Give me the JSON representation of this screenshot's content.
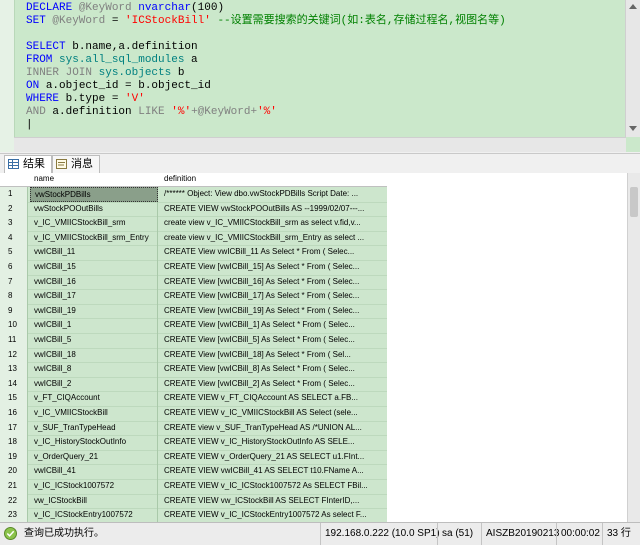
{
  "editor": {
    "lines": [
      {
        "parts": [
          {
            "c": "kw",
            "t": "DECLARE "
          },
          {
            "c": "gray",
            "t": "@KeyWord "
          },
          {
            "c": "kw",
            "t": "nvarchar"
          },
          {
            "c": "var",
            "t": "(100)"
          }
        ]
      },
      {
        "parts": [
          {
            "c": "kw",
            "t": "SET "
          },
          {
            "c": "gray",
            "t": "@KeyWord "
          },
          {
            "c": "var",
            "t": "= "
          },
          {
            "c": "str",
            "t": "'ICStockBill'"
          },
          {
            "c": "cmt",
            "t": " --设置需要搜索的关键词(如:表名,存储过程名,视图名等)"
          }
        ]
      },
      {
        "parts": []
      },
      {
        "parts": [
          {
            "c": "kw",
            "t": "SELECT "
          },
          {
            "c": "var",
            "t": "b.name,a.definition"
          }
        ]
      },
      {
        "parts": [
          {
            "c": "kw",
            "t": "FROM "
          },
          {
            "c": "obj",
            "t": "sys.all_sql_modules "
          },
          {
            "c": "var",
            "t": "a"
          }
        ]
      },
      {
        "parts": [
          {
            "c": "gray",
            "t": "INNER JOIN "
          },
          {
            "c": "obj",
            "t": "sys.objects "
          },
          {
            "c": "var",
            "t": "b"
          }
        ]
      },
      {
        "parts": [
          {
            "c": "kw",
            "t": "ON "
          },
          {
            "c": "var",
            "t": "a.object_id = b.object_id"
          }
        ]
      },
      {
        "parts": [
          {
            "c": "kw",
            "t": "WHERE "
          },
          {
            "c": "var",
            "t": "b.type = "
          },
          {
            "c": "str",
            "t": "'V'"
          }
        ]
      },
      {
        "parts": [
          {
            "c": "gray",
            "t": "AND "
          },
          {
            "c": "var",
            "t": "a.definition "
          },
          {
            "c": "gray",
            "t": "LIKE "
          },
          {
            "c": "str",
            "t": "'%'"
          },
          {
            "c": "gray",
            "t": "+@KeyWord+"
          },
          {
            "c": "str",
            "t": "'%'"
          }
        ]
      },
      {
        "parts": [
          {
            "c": "var",
            "t": "|"
          }
        ]
      }
    ]
  },
  "tabs": [
    {
      "label": "结果",
      "active": true
    },
    {
      "label": "消息",
      "active": false
    }
  ],
  "grid": {
    "columns": [
      "name",
      "definition"
    ],
    "rows": [
      [
        "1",
        "vwStockPDBills",
        "/****** Object:  View dbo.vwStockPDBills    Script Date: ..."
      ],
      [
        "2",
        "vwStockPOOutBills",
        "CREATE VIEW vwStockPOOutBills AS  --1999/02/07---..."
      ],
      [
        "3",
        "v_IC_VMIICStockBill_srm",
        "  create view  v_IC_VMIICStockBill_srm  as   select v.fid,v..."
      ],
      [
        "4",
        "v_IC_VMIICStockBill_srm_Entry",
        "  create view  v_IC_VMIICStockBill_srm_Entry  as   select ..."
      ],
      [
        "5",
        "vwICBill_11",
        "CREATE View vwICBill_11 As        Select * From ( Selec..."
      ],
      [
        "6",
        "vwICBill_15",
        "CREATE  View [vwICBill_15] As       Select * From ( Selec..."
      ],
      [
        "7",
        "vwICBill_16",
        "CREATE  View [vwICBill_16] As       Select * From ( Selec..."
      ],
      [
        "8",
        "vwICBill_17",
        "CREATE  View [vwICBill_17] As       Select * From ( Selec..."
      ],
      [
        "9",
        "vwICBill_19",
        "CREATE  View [vwICBill_19] As       Select * From ( Selec..."
      ],
      [
        "10",
        "vwICBill_1",
        "CREATE View [vwICBill_1]  As      Select * From ( Selec..."
      ],
      [
        "11",
        "vwICBill_5",
        "CREATE  View [vwICBill_5] As       Select * From ( Selec..."
      ],
      [
        "12",
        "vwICBill_18",
        "CREATE  View [vwICBill_18] As       Select * From ( Sel..."
      ],
      [
        "13",
        "vwICBill_8",
        "CREATE  View [vwICBill_8] As       Select * From ( Selec..."
      ],
      [
        "14",
        "vwICBill_2",
        "CREATE  View [vwICBill_2] As       Select * From ( Selec..."
      ],
      [
        "15",
        "v_FT_CIQAccount",
        "CREATE VIEW v_FT_CIQAccount   AS       SELECT a.FB..."
      ],
      [
        "16",
        "v_IC_VMIICStockBill",
        "CREATE VIEW v_IC_VMIICStockBill   AS        Select (sele..."
      ],
      [
        "17",
        "v_SUF_TranTypeHead",
        "CREATE view v_SUF_TranTypeHead AS   /*UNION AL..."
      ],
      [
        "18",
        "v_IC_HistoryStockOutInfo",
        "CREATE VIEW v_IC_HistoryStockOutInfo    AS     SELE..."
      ],
      [
        "19",
        "v_OrderQuery_21",
        "CREATE VIEW v_OrderQuery_21  AS SELECT u1.FInt..."
      ],
      [
        "20",
        "vwICBill_41",
        "CREATE VIEW vwICBill_41  AS   SELECT t10.FName A..."
      ],
      [
        "21",
        "v_IC_ICStock1007572",
        "CREATE VIEW v_IC_ICStock1007572  As   SELECT FBil..."
      ],
      [
        "22",
        "vw_ICStockBill",
        "CREATE VIEW vw_ICStockBill     AS SELECT FInterID,..."
      ],
      [
        "23",
        "v_IC_ICStockEntry1007572",
        "CREATE VIEW v_IC_ICStockEntry1007572  As  select F..."
      ]
    ]
  },
  "status": {
    "message": "查询已成功执行。",
    "server": "192.168.0.222 (10.0 SP1)",
    "user": "sa (51)",
    "database": "AISZB20190213",
    "time": "00:00:02",
    "rows": "33 行"
  }
}
